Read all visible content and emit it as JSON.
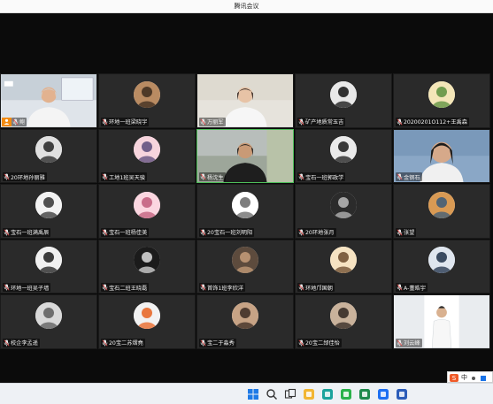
{
  "window": {
    "title": "腾讯会议"
  },
  "participants": [
    {
      "name": "鲍",
      "type": "camera",
      "host": true,
      "scene": "man-window"
    },
    {
      "name": "环地一班梁晓宇",
      "type": "avatar",
      "avatar": "cat-avatar"
    },
    {
      "name": "万丽军",
      "type": "camera",
      "scene": "woman-room"
    },
    {
      "name": "矿产地质常玉吉",
      "type": "avatar",
      "avatar": "anime-dark-hair-avatar"
    },
    {
      "name": "20200201O112+王禹森",
      "type": "avatar",
      "avatar": "cartoon-kid-avatar"
    },
    {
      "name": "20环地孙丽雅",
      "type": "avatar",
      "avatar": "anime-boy-avatar"
    },
    {
      "name": "工地1班吴天骏",
      "type": "avatar",
      "avatar": "anime-girl-flowers-avatar"
    },
    {
      "name": "杨沈生",
      "type": "camera",
      "scene": "man-room",
      "speaking": true
    },
    {
      "name": "宝石一班郭政学",
      "type": "avatar",
      "avatar": "anime-boy-dark-avatar"
    },
    {
      "name": "金钢石",
      "type": "camera",
      "scene": "woman-closeup"
    },
    {
      "name": "宝石一班满禹辰",
      "type": "avatar",
      "avatar": "anime-boy-sketch-avatar"
    },
    {
      "name": "宝石一班杨佳美",
      "type": "avatar",
      "avatar": "cute-cat-pink-avatar"
    },
    {
      "name": "20宝石一班刘明阳",
      "type": "avatar",
      "avatar": "lineart-avatar"
    },
    {
      "name": "20环地张月",
      "type": "avatar",
      "avatar": "dark-portrait-avatar"
    },
    {
      "name": "张望",
      "type": "avatar",
      "avatar": "sunset-avatar"
    },
    {
      "name": "环地一班吴子墙",
      "type": "avatar",
      "avatar": "anime-boy-bw-avatar"
    },
    {
      "name": "宝石二班王晓磊",
      "type": "avatar",
      "avatar": "black-cat-avatar"
    },
    {
      "name": "首饰1班李欣洋",
      "type": "avatar",
      "avatar": "group-photo-avatar"
    },
    {
      "name": "环地邝国朝",
      "type": "avatar",
      "avatar": "cartoon-face-avatar"
    },
    {
      "name": "A-董晧宇",
      "type": "avatar",
      "avatar": "anime-dark-avatar"
    },
    {
      "name": "校企李孟遥",
      "type": "avatar",
      "avatar": "ear-icon-avatar"
    },
    {
      "name": "20宝二苏熠堯",
      "type": "avatar",
      "avatar": "duck-avatar"
    },
    {
      "name": "宝二于淼秀",
      "type": "avatar",
      "avatar": "woman-avatar"
    },
    {
      "name": "20宝二邰佳怡",
      "type": "avatar",
      "avatar": "portrait-avatar"
    },
    {
      "name": "刘云峰",
      "type": "camera",
      "scene": "man-standing"
    }
  ],
  "taskbar": {
    "icons": [
      "windows-start-icon",
      "search-icon",
      "task-view-icon",
      "file-explorer-icon",
      "edge-browser-icon",
      "wechat-icon",
      "excel-icon",
      "tencent-meeting-icon",
      "word-icon"
    ]
  },
  "ime": {
    "lang": "中"
  },
  "colors": {
    "host_badge": "#f28a0f",
    "speaking_border": "#4fbf5a",
    "tile_bg": "#2a2a2a"
  }
}
